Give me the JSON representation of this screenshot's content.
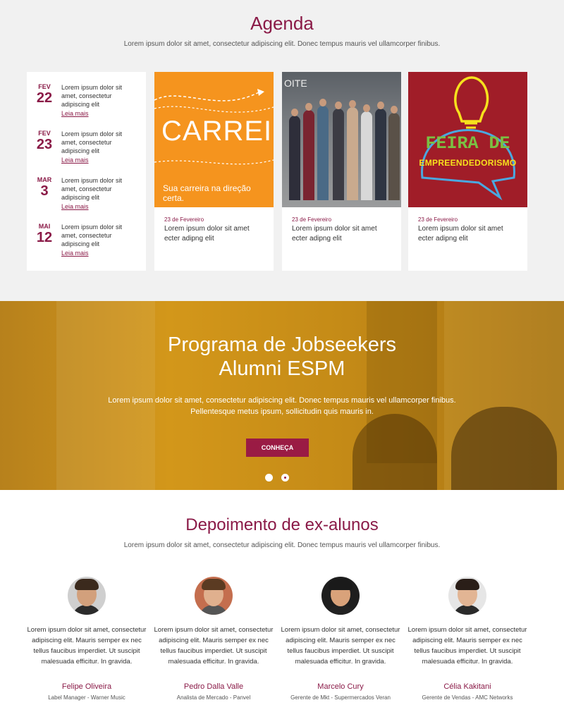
{
  "agenda": {
    "title": "Agenda",
    "subtitle": "Lorem ipsum dolor sit amet, consectetur adipiscing elit. Donec tempus mauris vel ullamcorper finibus.",
    "events": [
      {
        "month": "FEV",
        "day": "22",
        "text": "Lorem ipsum dolor sit amet, consectetur adipiscing elit",
        "link": "Leia mais"
      },
      {
        "month": "FEV",
        "day": "23",
        "text": "Lorem ipsum dolor sit amet, consectetur adipiscing elit",
        "link": "Leia mais"
      },
      {
        "month": "MAR",
        "day": "3",
        "text": "Lorem ipsum dolor sit amet, consectetur adipiscing elit",
        "link": "Leia mais"
      },
      {
        "month": "MAI",
        "day": "12",
        "text": "Lorem ipsum dolor sit amet, consectetur adipiscing elit",
        "link": "Leia mais"
      }
    ],
    "cards": [
      {
        "image_word": "CARREIRAS",
        "image_tagline": "Sua carreira na direção certa.",
        "date": "23 de Fevereiro",
        "text": "Lorem ipsum dolor sit amet ecter adipng elit"
      },
      {
        "image_word": "OITE",
        "date": "23 de Fevereiro",
        "text": "Lorem ipsum dolor sit amet ecter adipng elit"
      },
      {
        "image_word": "FEIRA DE",
        "image_tagline": "EMPREENDEDORISMO",
        "date": "23 de Fevereiro",
        "text": "Lorem ipsum dolor sit amet ecter adipng elit"
      }
    ]
  },
  "banner": {
    "title_line1": "Programa de Jobseekers",
    "title_line2": "Alumni ESPM",
    "description": "Lorem ipsum dolor sit amet, consectetur adipiscing elit. Donec tempus mauris vel ullamcorper finibus. Pellentesque metus ipsum, sollicitudin quis mauris in.",
    "button": "CONHEÇA"
  },
  "testimonials": {
    "title": "Depoimento de ex-alunos",
    "subtitle": "Lorem ipsum dolor sit amet, consectetur adipiscing elit. Donec tempus mauris vel ullamcorper finibus.",
    "items": [
      {
        "quote": "Lorem ipsum dolor sit amet, consectetur adipiscing elit. Mauris semper ex nec tellus faucibus imperdiet. Ut suscipit malesuada efficitur. In gravida.",
        "name": "Felipe Oliveira",
        "role": "Label Manager - Warner Music"
      },
      {
        "quote": "Lorem ipsum dolor sit amet, consectetur adipiscing elit. Mauris semper ex nec tellus faucibus imperdiet. Ut suscipit malesuada efficitur. In gravida.",
        "name": "Pedro Dalla Valle",
        "role": "Analista de Mercado - Panvel"
      },
      {
        "quote": "Lorem ipsum dolor sit amet, consectetur adipiscing elit. Mauris semper ex nec tellus faucibus imperdiet. Ut suscipit malesuada efficitur. In gravida.",
        "name": "Marcelo Cury",
        "role": "Gerente de Mkt - Supermercados Veran"
      },
      {
        "quote": "Lorem ipsum dolor sit amet, consectetur adipiscing elit. Mauris semper ex nec tellus faucibus imperdiet. Ut suscipit malesuada efficitur. In gravida.",
        "name": "Célia Kakitani",
        "role": "Gerente de Vendas - AMC Networks"
      }
    ]
  },
  "colors": {
    "brand": "#8a1a47",
    "banner": "#d3971a",
    "button": "#9a1b44",
    "agenda_bg": "#f1f1f1"
  }
}
